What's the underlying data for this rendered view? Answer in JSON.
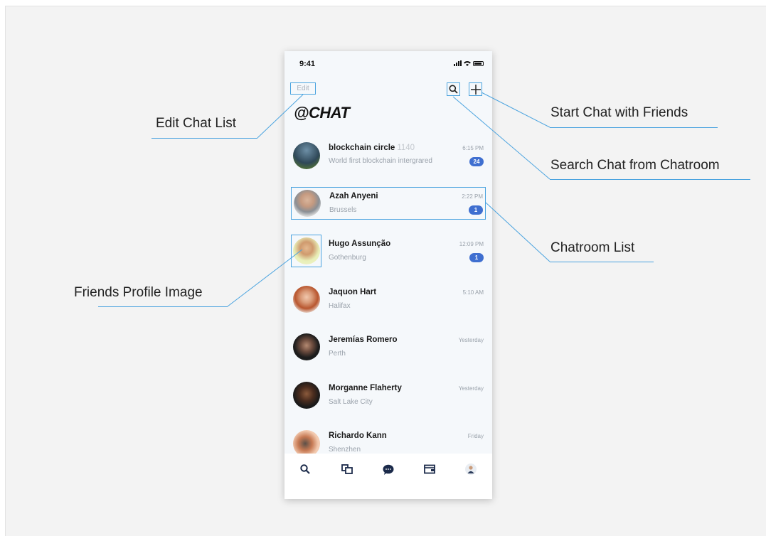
{
  "status": {
    "time": "9:41"
  },
  "header": {
    "edit_label": "Edit",
    "title": "@CHAT"
  },
  "chats": [
    {
      "name": "blockchain circle",
      "count": "1140",
      "preview": "World first blockchain intergrared",
      "time": "6:15 PM",
      "badge": "24"
    },
    {
      "name": "Azah Anyeni",
      "preview": "Brussels",
      "time": "2:22 PM",
      "badge": "1"
    },
    {
      "name": "Hugo Assunção",
      "preview": "Gothenburg",
      "time": "12:09 PM",
      "badge": "1"
    },
    {
      "name": "Jaquon Hart",
      "preview": "Halifax",
      "time": "5:10 AM"
    },
    {
      "name": "Jeremías Romero",
      "preview": "Perth",
      "time": "Yesterday"
    },
    {
      "name": "Morganne Flaherty",
      "preview": "Salt Lake City",
      "time": "Yesterday"
    },
    {
      "name": "Richardo Kann",
      "preview": "Shenzhen",
      "time": "Friday"
    }
  ],
  "annotations": {
    "edit": "Edit Chat List",
    "start": "Start Chat with Friends",
    "search": "Search Chat from Chatroom",
    "list": "Chatroom List",
    "profile": "Friends Profile Image"
  },
  "tabs": [
    "search-icon",
    "chats-icon",
    "message-icon",
    "wallet-icon",
    "profile-icon"
  ],
  "colors": {
    "accent": "#4aa3df",
    "badge": "#3f6fd0",
    "background": "#f3f3f3"
  }
}
